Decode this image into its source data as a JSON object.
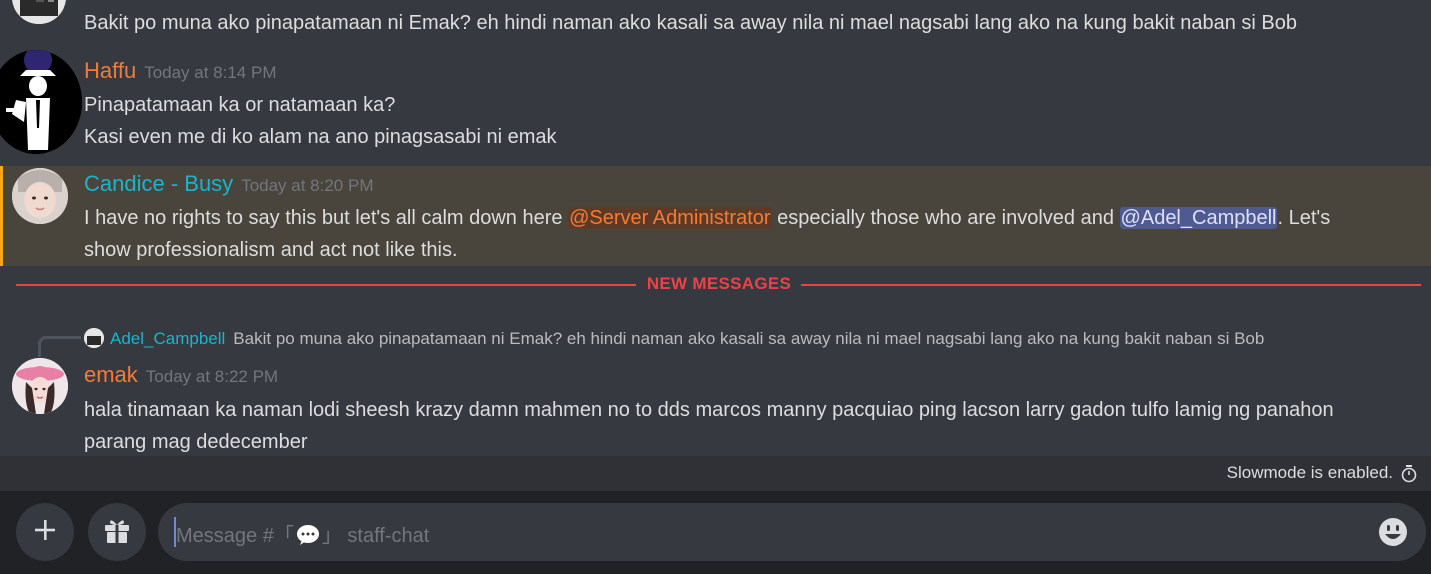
{
  "messages": {
    "m0": {
      "text": "Bakit po muna ako pinapatamaan ni Emak? eh hindi naman ako kasali sa away nila ni mael nagsabi lang ako na kung bakit naban si Bob"
    },
    "m1": {
      "author": "Haffu",
      "author_color": "#f47b36",
      "timestamp": "Today at 8:14 PM",
      "lines": [
        "Pinapatamaan ka or natamaan ka?",
        "Kasi even me di ko alam na ano pinagsasabi ni emak"
      ]
    },
    "m2": {
      "author": "Candice - Busy",
      "author_color": "#1ab4cc",
      "timestamp": "Today at 8:20 PM",
      "text_before": "I have no rights to say this but let's all calm down here ",
      "mention1": "@Server Administrator",
      "text_middle": " especially those who are involved and ",
      "mention2": "@Adel_Campbell",
      "text_after": ". Let's",
      "line2": "show professionalism and act not like this."
    },
    "divider": {
      "label": "NEW MESSAGES",
      "color": "#ed4245"
    },
    "m3": {
      "reply_author": "Adel_Campbell",
      "reply_text": "Bakit po muna ako pinapatamaan ni Emak? eh hindi naman ako kasali sa away nila ni mael nagsabi lang ako na kung bakit naban si Bob",
      "author": "emak",
      "author_color": "#f47b36",
      "timestamp": "Today at 8:22 PM",
      "lines": [
        "hala tinamaan ka naman lodi sheesh krazy damn mahmen no to dds marcos manny pacquiao ping lacson larry gadon tulfo lamig ng panahon",
        "parang mag dedecember"
      ]
    }
  },
  "slowmode": {
    "text": "Slowmode is enabled.",
    "icon": "timer-icon"
  },
  "composer": {
    "add_icon": "plus-icon",
    "gift_icon": "gift-icon",
    "placeholder_prefix": "Message #「",
    "placeholder_suffix": "」 staff-chat",
    "channel_icon": "speech-bubble-icon",
    "emoji_icon": "emoji-icon"
  },
  "colors": {
    "background": "#36393f",
    "mention_role_bg": "#5c3a26",
    "mention_role_fg": "#f47b36",
    "mention_user_bg": "#4e5a90",
    "mention_user_fg": "#dee0fc",
    "highlight_bg": "#49443c",
    "highlight_bar": "#faa81a"
  }
}
